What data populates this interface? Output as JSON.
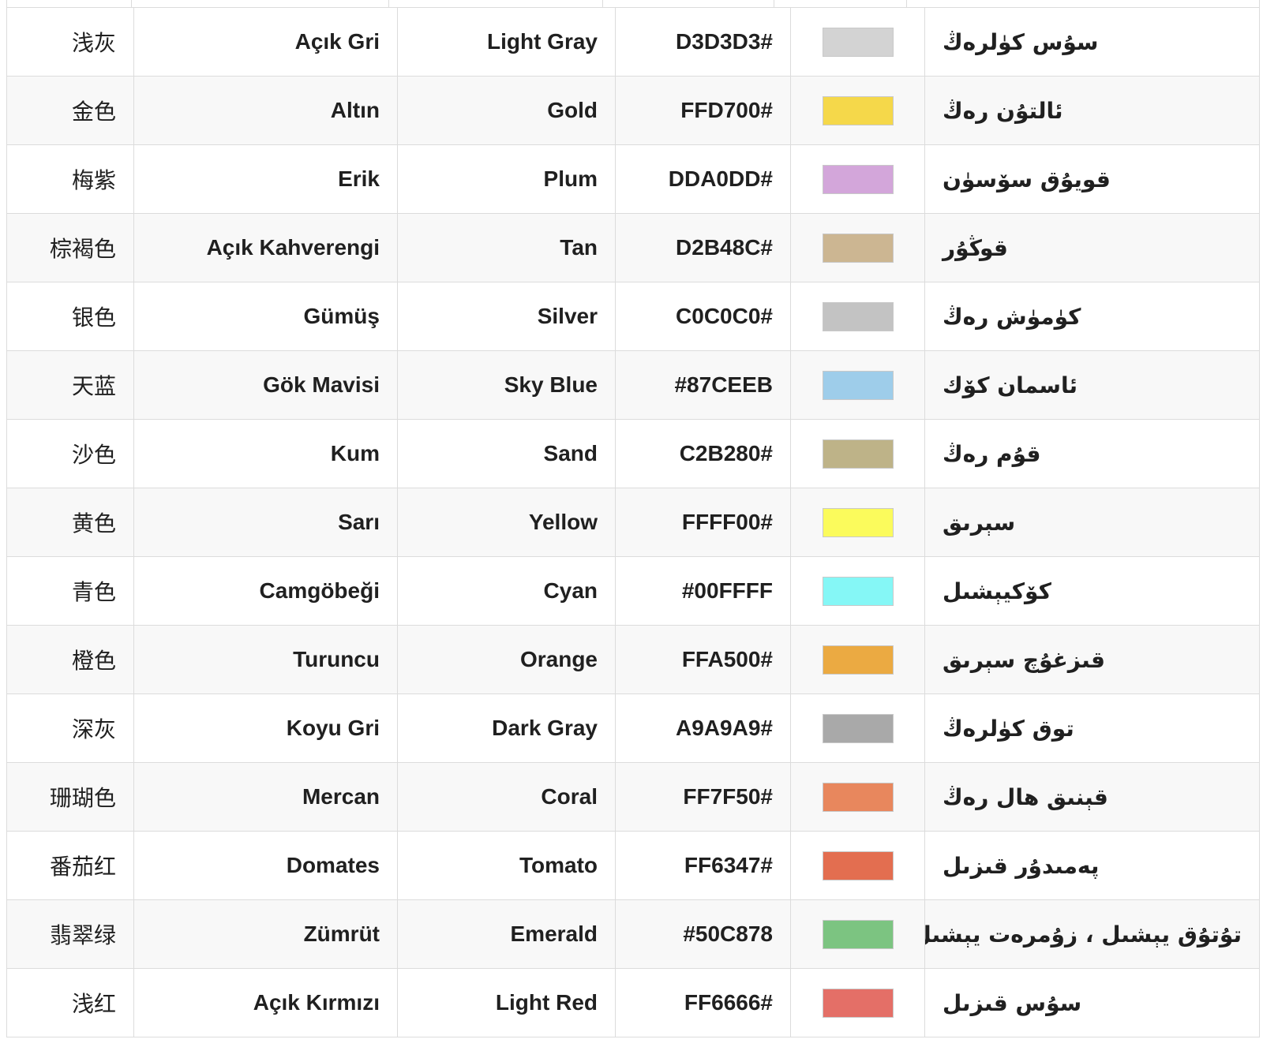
{
  "rows": [
    {
      "zh": "浅灰",
      "tr": "Açık Gri",
      "en": "Light Gray",
      "hex": "D3D3D3#",
      "color": "#D3D3D3",
      "ug": "سۇس كۈلرەڭ"
    },
    {
      "zh": "金色",
      "tr": "Altın",
      "en": "Gold",
      "hex": "FFD700#",
      "color": "#F5D84A",
      "ug": "ئالتۇن رەڭ"
    },
    {
      "zh": "梅紫",
      "tr": "Erik",
      "en": "Plum",
      "hex": "DDA0DD#",
      "color": "#D3A6DA",
      "ug": "قويۇق سۆسۈن"
    },
    {
      "zh": "棕褐色",
      "tr": "Açık Kahverengi",
      "en": "Tan",
      "hex": "D2B48C#",
      "color": "#CCB692",
      "ug": "قوڭۇر"
    },
    {
      "zh": "银色",
      "tr": "Gümüş",
      "en": "Silver",
      "hex": "C0C0C0#",
      "color": "#C3C3C3",
      "ug": "كۈمۈش رەڭ"
    },
    {
      "zh": "天蓝",
      "tr": "Gök Mavisi",
      "en": "Sky Blue",
      "hex": "#87CEEB",
      "color": "#9ECDEA",
      "ug": "ئاسمان كۆك"
    },
    {
      "zh": "沙色",
      "tr": "Kum",
      "en": "Sand",
      "hex": "C2B280#",
      "color": "#BEB388",
      "ug": "قۇم رەڭ"
    },
    {
      "zh": "黄色",
      "tr": "Sarı",
      "en": "Yellow",
      "hex": "FFFF00#",
      "color": "#FBFB5C",
      "ug": "سېرىق"
    },
    {
      "zh": "青色",
      "tr": "Camgöbeği",
      "en": "Cyan",
      "hex": "#00FFFF",
      "color": "#85F7F6",
      "ug": "كۆكيېشىل"
    },
    {
      "zh": "橙色",
      "tr": "Turuncu",
      "en": "Orange",
      "hex": "FFA500#",
      "color": "#EBAA42",
      "ug": "قىزغۇچ سېرىق"
    },
    {
      "zh": "深灰",
      "tr": "Koyu Gri",
      "en": "Dark Gray",
      "hex": "A9A9A9#",
      "color": "#A9A9A9",
      "ug": "توق كۈلرەڭ"
    },
    {
      "zh": "珊瑚色",
      "tr": "Mercan",
      "en": "Coral",
      "hex": "FF7F50#",
      "color": "#E8875D",
      "ug": "قېنىق ھال رەڭ"
    },
    {
      "zh": "番茄红",
      "tr": "Domates",
      "en": "Tomato",
      "hex": "FF6347#",
      "color": "#E36E50",
      "ug": "پەمىدۇر قىزىل"
    },
    {
      "zh": "翡翠绿",
      "tr": "Zümrüt",
      "en": "Emerald",
      "hex": "#50C878",
      "color": "#7CC481",
      "ug": "تۇتۇق يېشىل ، زۇمرەت يېشىل"
    },
    {
      "zh": "浅红",
      "tr": "Açık Kırmızı",
      "en": "Light Red",
      "hex": "FF6666#",
      "color": "#E46F67",
      "ug": "سۇس قىزىل"
    }
  ]
}
